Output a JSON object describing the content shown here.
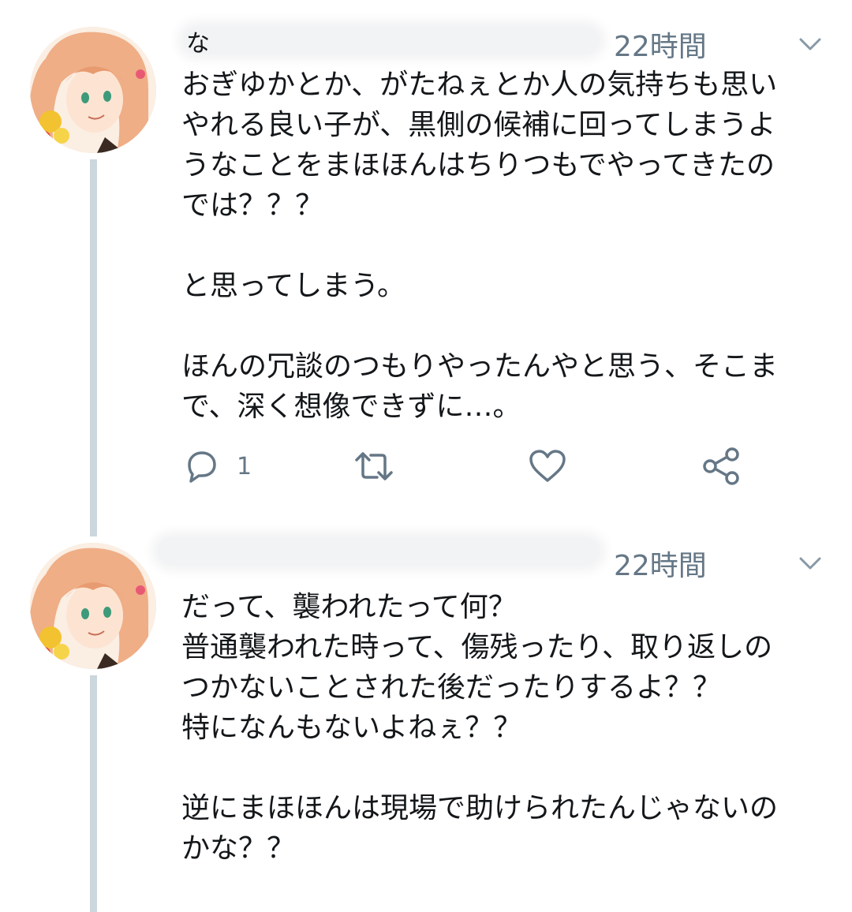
{
  "tweets": [
    {
      "name_visible": "な",
      "timestamp": "22時間",
      "text": "おぎゆかとか、がたねぇとか人の気持ちも思い\nやれる良い子が、黒側の候補に回ってしまうよ\nうなことをまほほんはちりつもでやってきたの\nでは？？？\n\nと思ってしまう。\n\nほんの冗談のつもりやったんやと思う、そこま\nで、深く想像できずに…。",
      "reply_count": "1",
      "icons": {
        "reply": "reply-icon",
        "retweet": "retweet-icon",
        "like": "like-icon",
        "share": "share-icon",
        "caret": "chevron-down-icon"
      }
    },
    {
      "timestamp": "22時間",
      "text": "だって、襲われたって何？\n普通襲われた時って、傷残ったり、取り返しの\nつかないことされた後だったりするよ？？\n特になんもないよねぇ？？\n\n逆にまほほんは現場で助けられたんじゃないの\nかな？？",
      "icons": {
        "caret": "chevron-down-icon"
      }
    }
  ],
  "colors": {
    "text": "#14171a",
    "secondary": "#657786",
    "thread_line": "#ccd6dd",
    "avatar_hair": "#f0b48c",
    "avatar_accent": "#f2c230"
  }
}
